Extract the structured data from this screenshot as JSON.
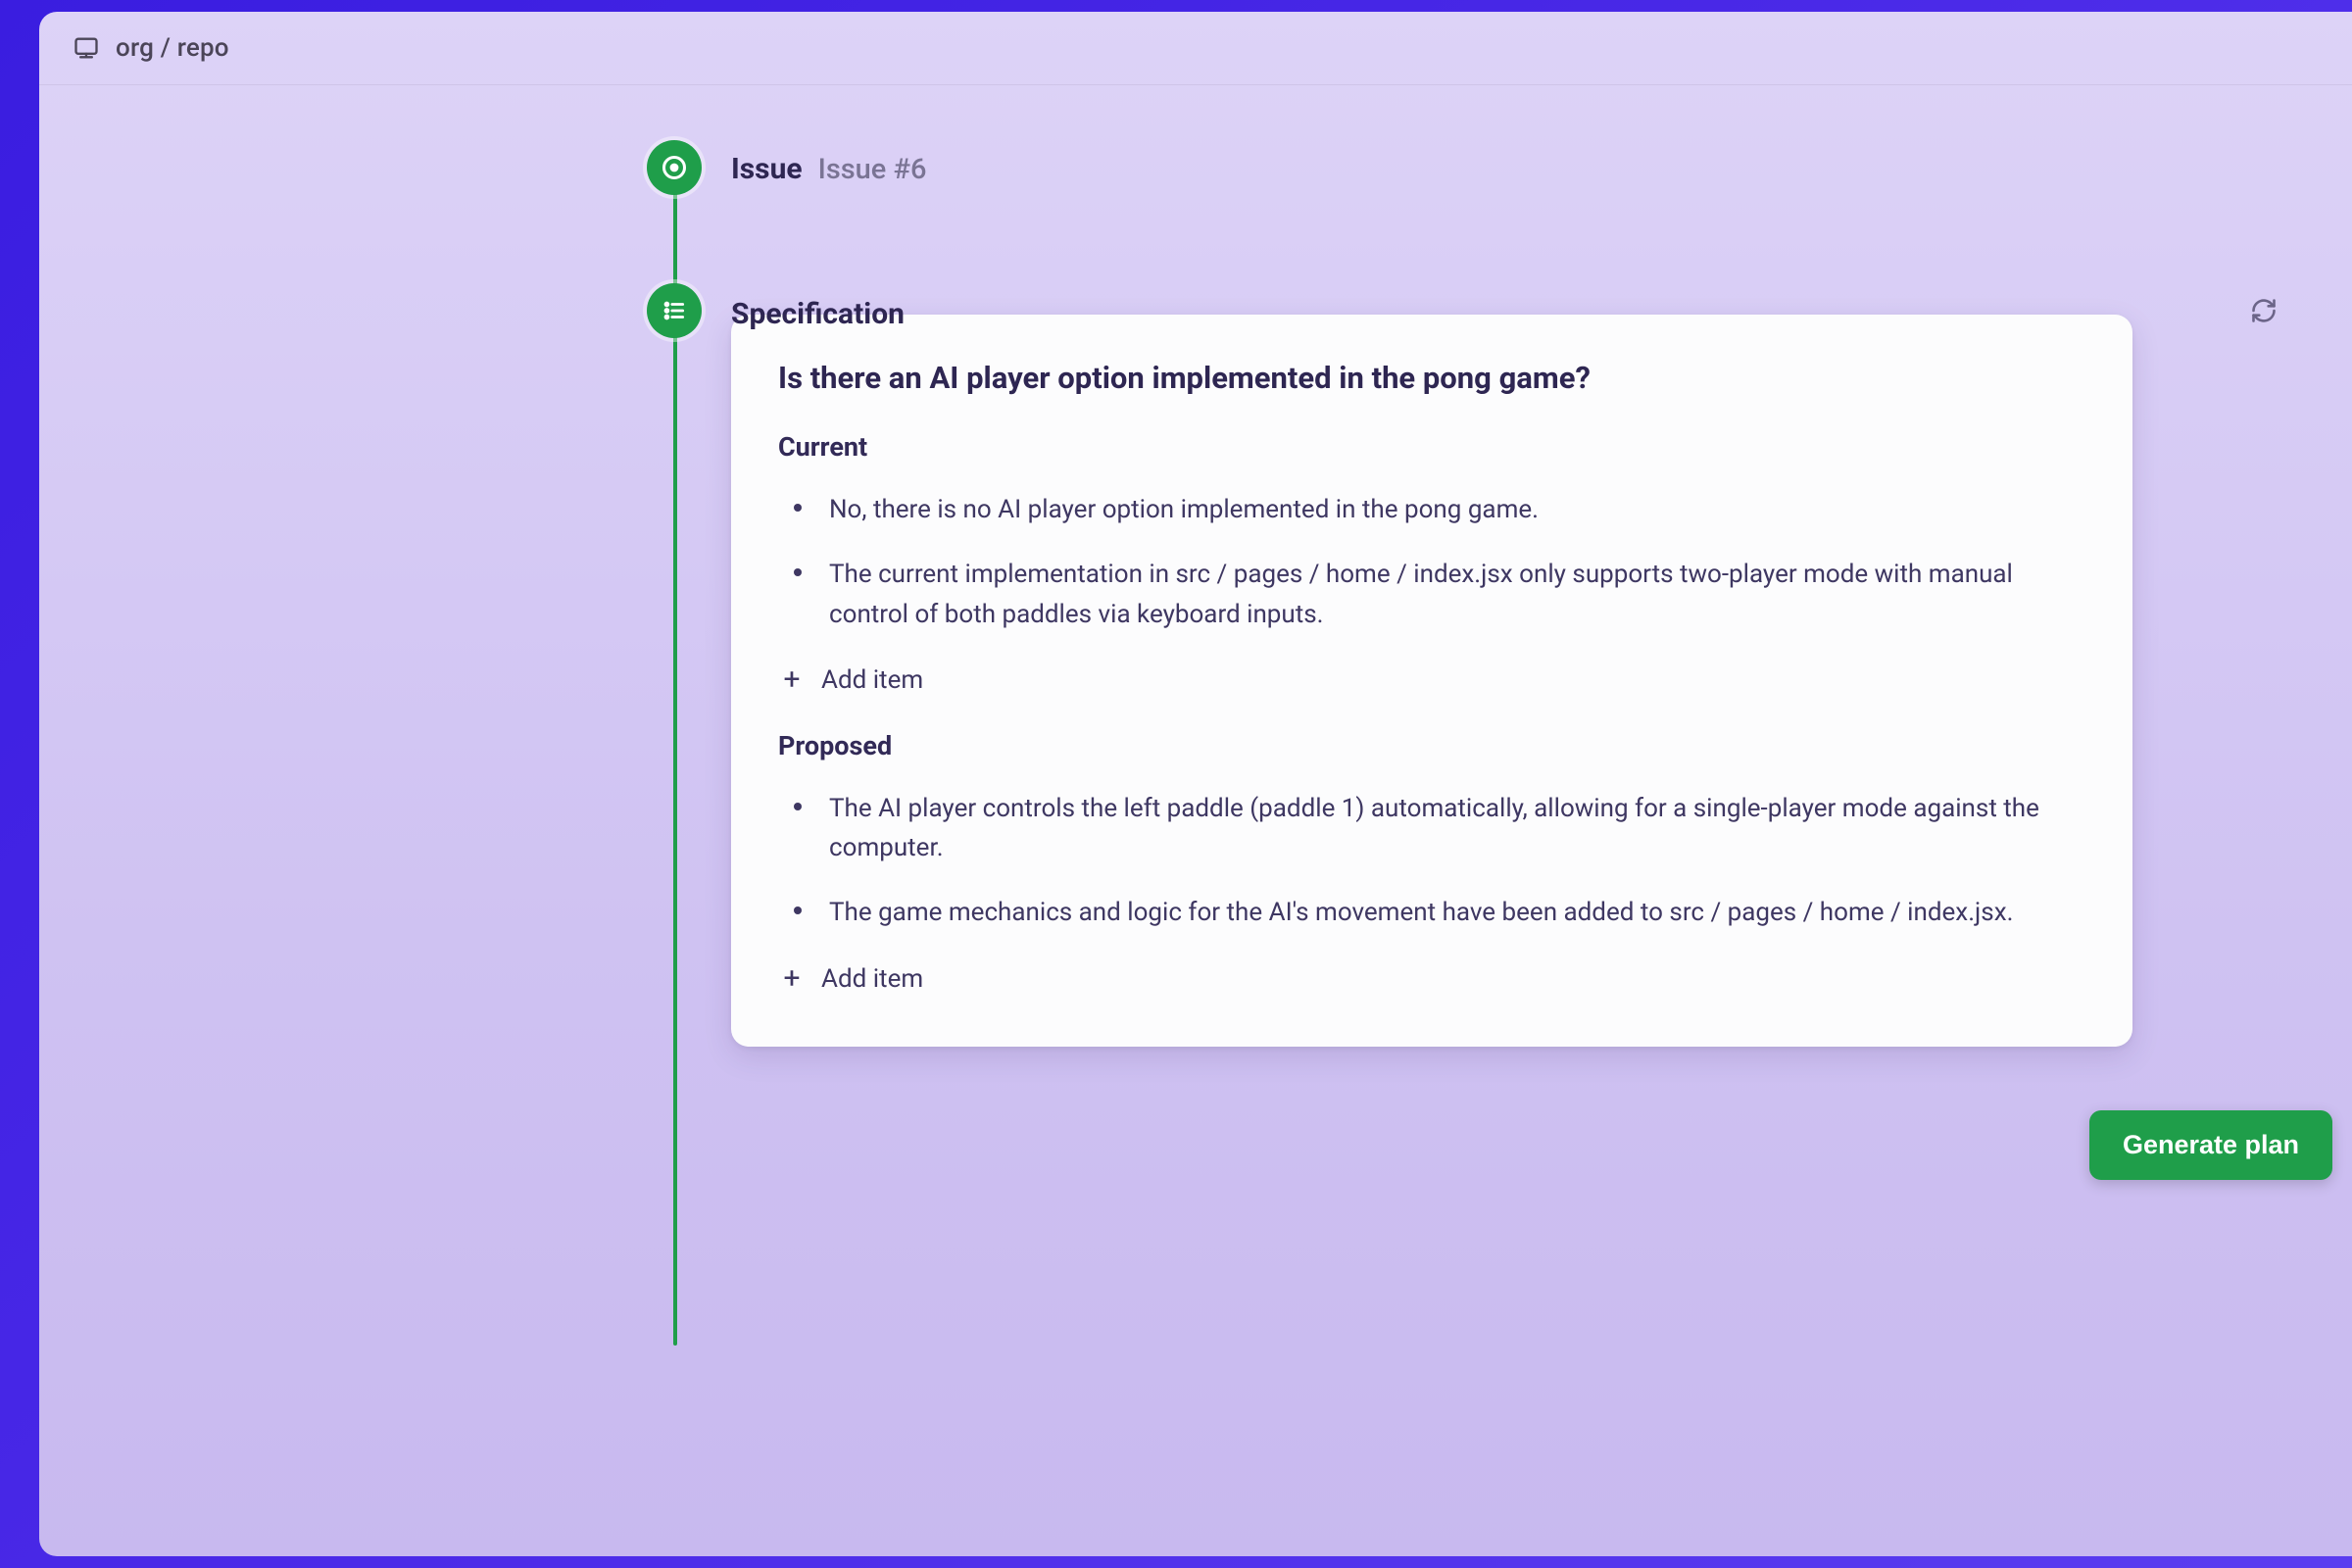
{
  "breadcrumb": "org / repo",
  "steps": {
    "issue": {
      "title": "Issue",
      "subtitle": "Issue #6"
    },
    "spec": {
      "title": "Specification"
    }
  },
  "card": {
    "question": "Is there an AI player option implemented in the pong game?",
    "current": {
      "title": "Current",
      "items": [
        "No, there is no AI player option implemented in the pong game.",
        "The current implementation in src / pages / home / index.jsx only supports two-player mode with manual control of both paddles via keyboard inputs."
      ],
      "add_label": "Add item"
    },
    "proposed": {
      "title": "Proposed",
      "items": [
        "The AI player controls the left paddle (paddle 1) automatically, allowing for a single-player mode against the computer.",
        "The game mechanics and logic for the AI's movement have been added to src / pages / home / index.jsx."
      ],
      "add_label": "Add item"
    }
  },
  "actions": {
    "generate_plan": "Generate plan"
  }
}
